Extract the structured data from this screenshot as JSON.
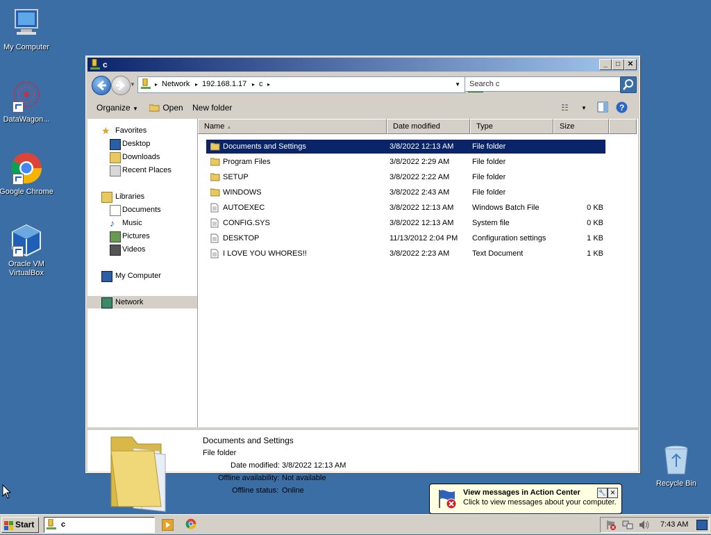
{
  "desktop": {
    "icons": [
      {
        "label": "My Computer"
      },
      {
        "label": "DataWagon..."
      },
      {
        "label": "Google Chrome"
      },
      {
        "label_line1": "Oracle VM",
        "label_line2": "VirtualBox"
      },
      {
        "label": "Recycle Bin"
      }
    ]
  },
  "window": {
    "title": "c",
    "address": {
      "segments": [
        "Network",
        "192.168.1.17",
        "c"
      ]
    },
    "search_placeholder": "Search c",
    "toolbar": {
      "organize": "Organize",
      "open": "Open",
      "new_folder": "New folder"
    },
    "nav": {
      "favorites": "Favorites",
      "desktop": "Desktop",
      "downloads": "Downloads",
      "recent": "Recent Places",
      "libraries": "Libraries",
      "documents": "Documents",
      "music": "Music",
      "pictures": "Pictures",
      "videos": "Videos",
      "computer": "My Computer",
      "network": "Network"
    },
    "columns": {
      "name": "Name",
      "date": "Date modified",
      "type": "Type",
      "size": "Size"
    },
    "files": [
      {
        "name": "Documents and Settings",
        "date": "3/8/2022 12:13 AM",
        "type": "File folder",
        "size": ""
      },
      {
        "name": "Program Files",
        "date": "3/8/2022 2:29 AM",
        "type": "File folder",
        "size": ""
      },
      {
        "name": "SETUP",
        "date": "3/8/2022 2:22 AM",
        "type": "File folder",
        "size": ""
      },
      {
        "name": "WINDOWS",
        "date": "3/8/2022 2:43 AM",
        "type": "File folder",
        "size": ""
      },
      {
        "name": "AUTOEXEC",
        "date": "3/8/2022 12:13 AM",
        "type": "Windows Batch File",
        "size": "0 KB"
      },
      {
        "name": "CONFIG.SYS",
        "date": "3/8/2022 12:13 AM",
        "type": "System file",
        "size": "0 KB"
      },
      {
        "name": "DESKTOP",
        "date": "11/13/2012 2:04 PM",
        "type": "Configuration settings",
        "size": "1 KB"
      },
      {
        "name": "I LOVE YOU WHORES!!",
        "date": "3/8/2022 2:23 AM",
        "type": "Text Document",
        "size": "1 KB"
      }
    ],
    "details": {
      "name": "Documents and Settings",
      "kind": "File folder",
      "date_label": "Date modified:",
      "date_value": "3/8/2022 12:13 AM",
      "offline_label": "Offline availability:",
      "offline_value": "Not available",
      "status_label": "Offline status:",
      "status_value": "Online"
    }
  },
  "balloon": {
    "title": "View messages in Action Center",
    "text": "Click to view messages about your computer."
  },
  "taskbar": {
    "start": "Start",
    "task": "c",
    "clock": "7:43 AM"
  },
  "colors": {
    "desktop": "#3a6ea5",
    "selection": "#0a246a",
    "title_start": "#0a246a"
  }
}
